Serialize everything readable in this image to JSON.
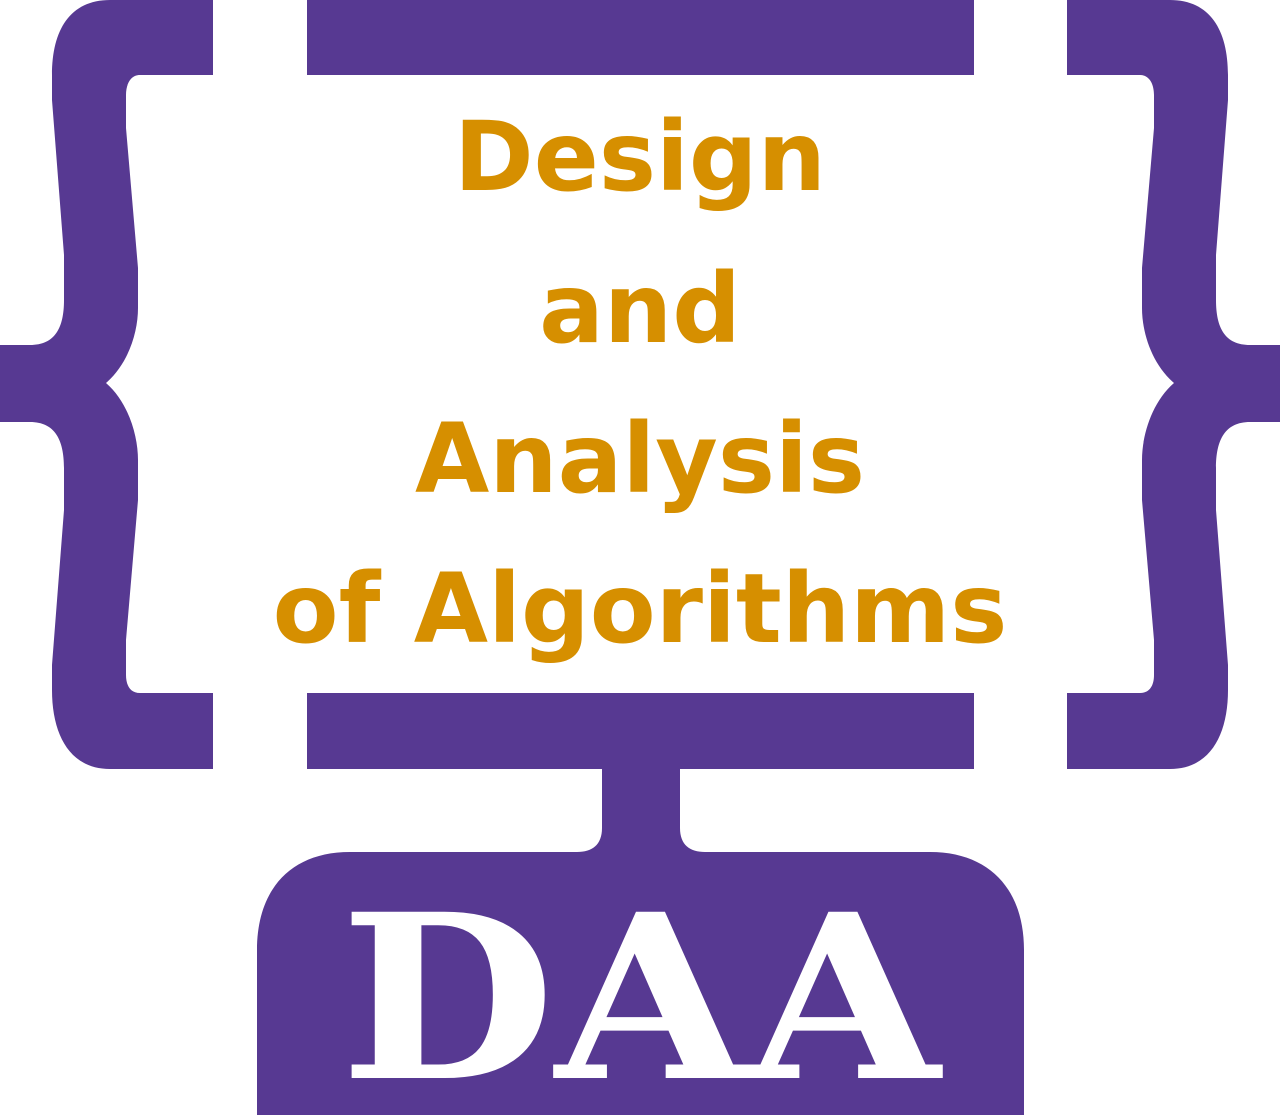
{
  "logo": {
    "title_lines": [
      "Design",
      "and",
      "Analysis",
      "of Algorithms"
    ],
    "abbreviation": "DAA"
  },
  "colors": {
    "frame": "#573992",
    "title_text": "#D68F00",
    "abbr_text": "#ffffff",
    "background": "#ffffff"
  },
  "icons": {
    "left_brace": "left-curly-brace",
    "right_brace": "right-curly-brace",
    "monitor_frame": "monitor-frame"
  }
}
